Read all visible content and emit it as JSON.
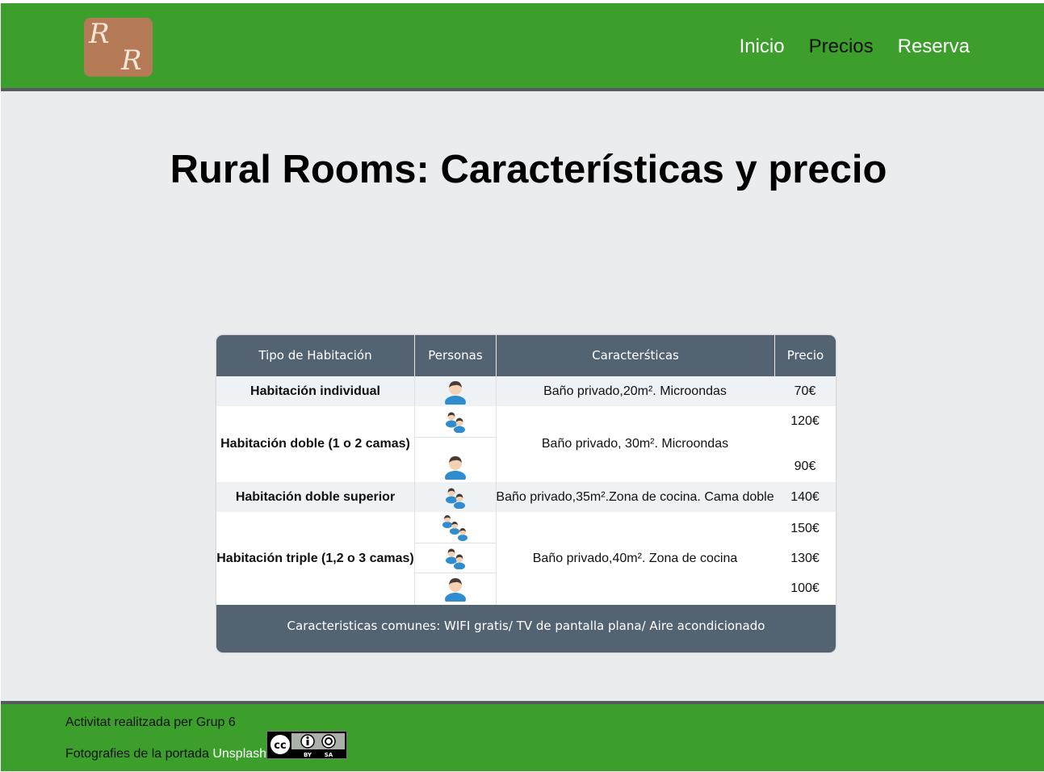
{
  "header": {
    "logo": {
      "letters": [
        "R",
        "R"
      ]
    },
    "nav": [
      {
        "label": "Inicio",
        "active": false
      },
      {
        "label": "Precios",
        "active": true
      },
      {
        "label": "Reserva",
        "active": false
      }
    ]
  },
  "page": {
    "title": "Rural Rooms: Características y precio"
  },
  "table": {
    "headers": [
      "Tipo de Habitación",
      "Personas",
      "Caracterśticas",
      "Precio"
    ],
    "rows": [
      {
        "type": "Habitación individual",
        "features": "Baño privado,20m². Microondas",
        "options": [
          {
            "persons": 1,
            "price": "70€"
          }
        ]
      },
      {
        "type": "Habitación doble (1 o 2 camas)",
        "features": "Baño privado, 30m². Microondas",
        "options": [
          {
            "persons": 2,
            "price": "120€"
          },
          {
            "persons": 1,
            "price": "90€"
          }
        ]
      },
      {
        "type": "Habitación doble superior",
        "features": "Baño privado,35m².Zona de cocina. Cama doble",
        "options": [
          {
            "persons": 2,
            "price": "140€"
          }
        ]
      },
      {
        "type": "Habitación triple (1,2 o 3 camas)",
        "features": "Baño privado,40m². Zona de cocina",
        "options": [
          {
            "persons": 3,
            "price": "150€"
          },
          {
            "persons": 2,
            "price": "130€"
          },
          {
            "persons": 1,
            "price": "100€"
          }
        ]
      }
    ],
    "footer": "Caracteristicas comunes: WIFI gratis/ TV de pantalla plana/ Aire acondicionado"
  },
  "colors": {
    "header_green": "#3c9e2b",
    "table_header": "#536372",
    "band": "#eef2f5"
  },
  "footer": {
    "credit": "Activitat realitzada per Grup 6",
    "photos_label": "Fotografies de la portada",
    "photos_link": "Unsplash",
    "license": {
      "icon": "creative-commons-by-sa-icon",
      "labels": [
        "BY",
        "SA"
      ]
    }
  }
}
